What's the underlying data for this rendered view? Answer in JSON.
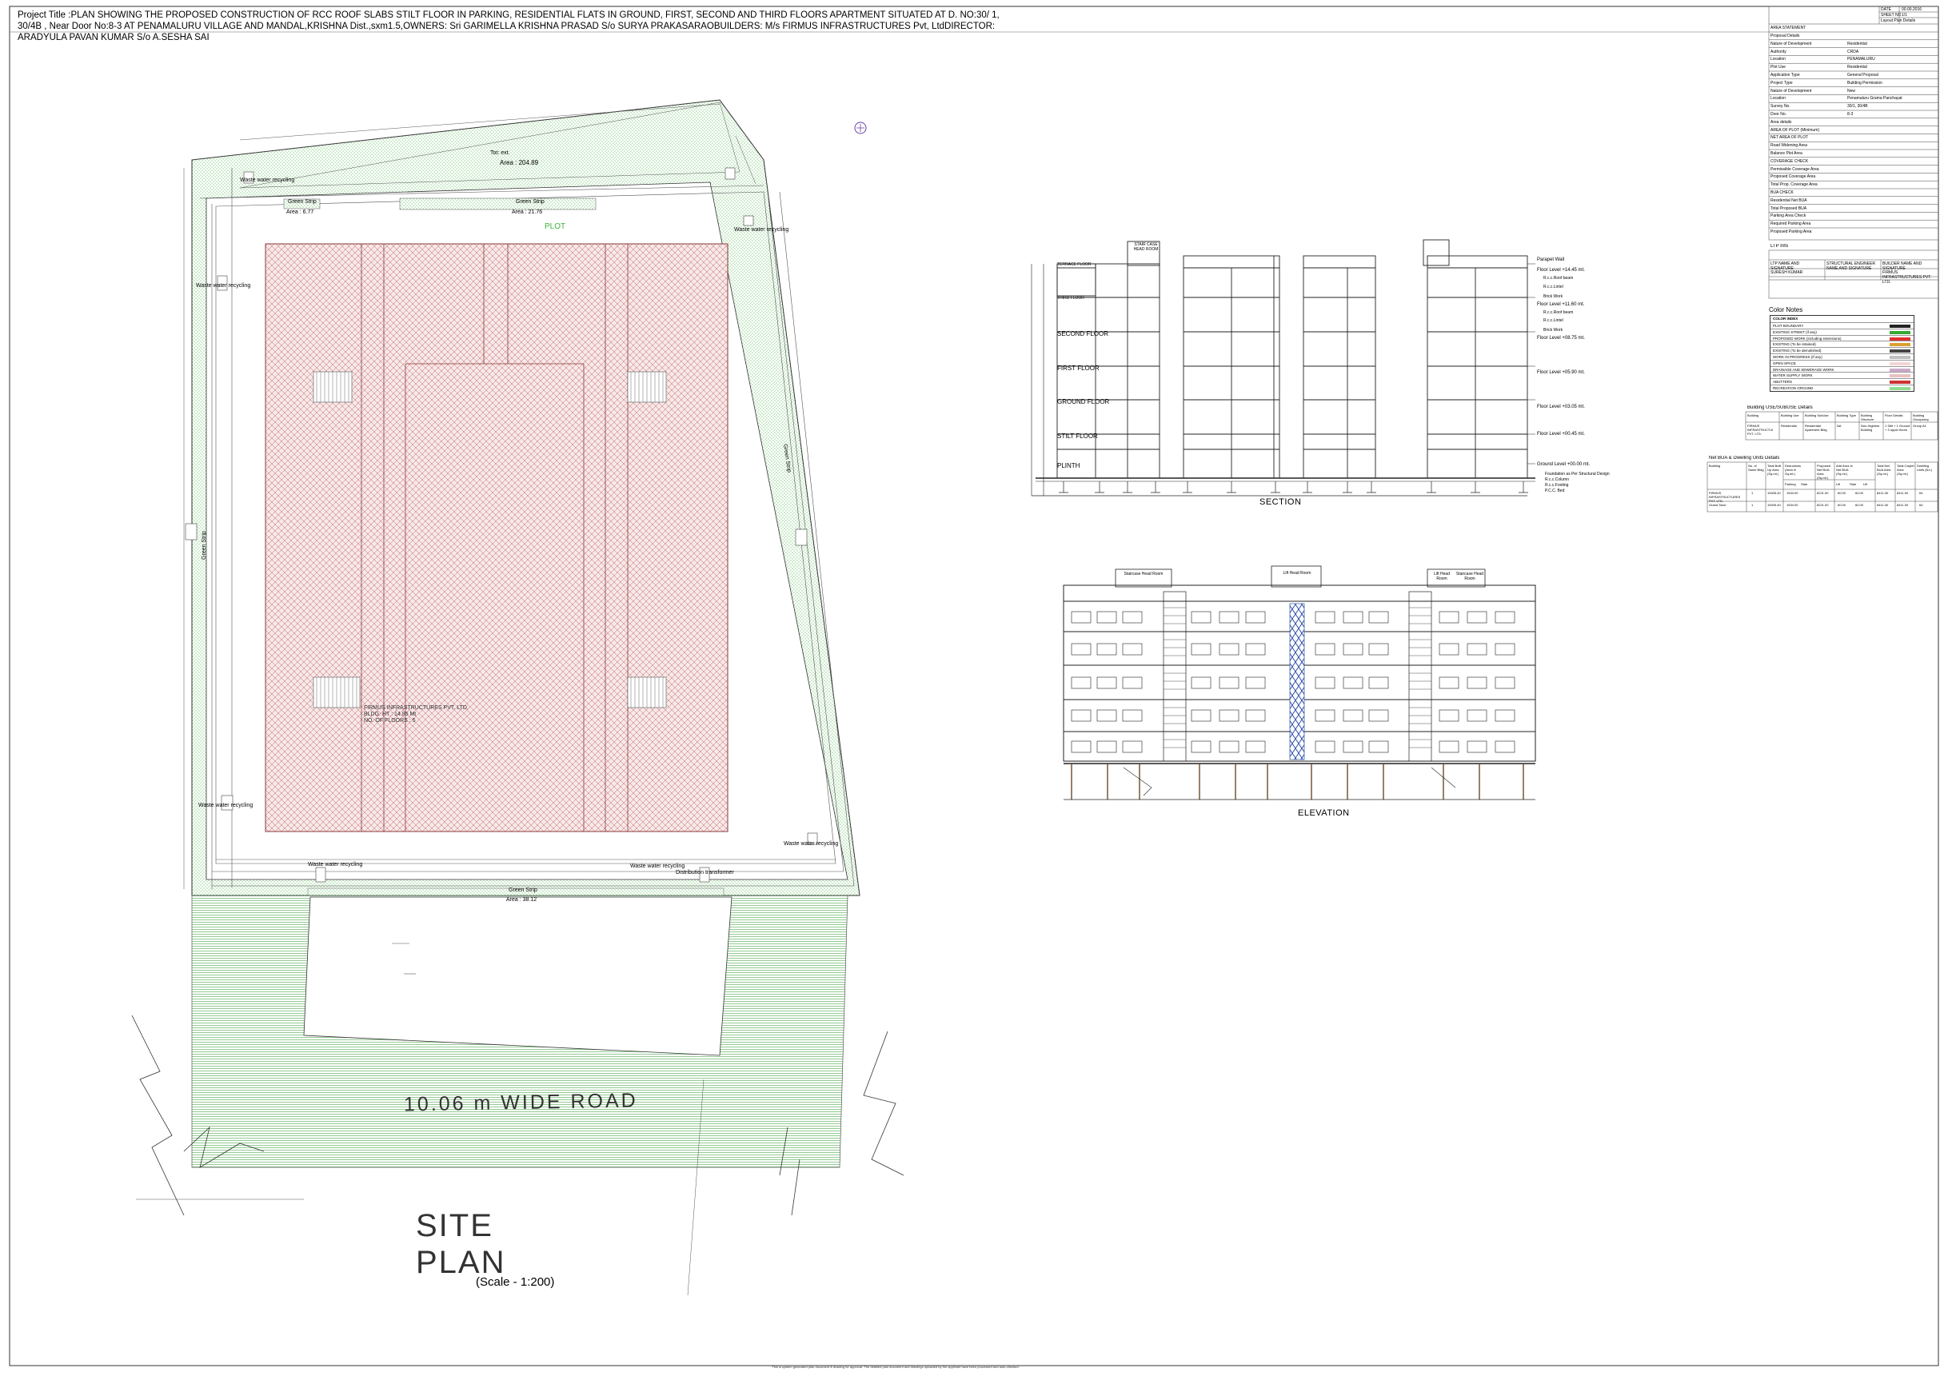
{
  "project_title": "Project Title :PLAN SHOWING THE PROPOSED CONSTRUCTION OF RCC ROOF SLABS STILT FLOOR IN PARKING, RESIDENTIAL FLATS IN GROUND, FIRST, SECOND AND THIRD FLOORS APARTMENT SITUATED AT D. NO:30/ 1, 30/4B , Near Door No:8-3 AT PENAMALURU VILLAGE AND MANDAL,KRISHNA Dist.,sxm1.5,OWNERS: Sri GARIMELLA KRISHNA PRASAD S/o SURYA PRAKASARAOBUILDERS: M/s FIRMUS INFRASTRUCTURES Pvt, LtdDIRECTOR: ARADYULA PAVAN KUMAR S/o A.SESHA SAI",
  "site_plan": {
    "tot_ext_label": "Tot: ext.",
    "tot_ext_area": "Area : 204.89",
    "green_strip_top_left": "Green Strip",
    "green_strip_top_left_area": "Area : 6.77",
    "green_strip_top": "Green Strip",
    "green_strip_top_area": "Area : 21.76",
    "plot_label": "PLOT",
    "green_strip_right": "Green Strip",
    "green_strip_left": "Green Strip",
    "green_strip_bottom": "Green Strip",
    "green_strip_bottom_area": "Area : 38.12",
    "waste_water": "Waste water recycling",
    "distribution_transformer": "Distribution transformer",
    "building_note": "FIRMUS INFRASTRUCTURES PVT. LTD.\nBLDG. HT : 14.85 Mt\nNO. OF FLOORS : 5",
    "road_label": "10.06  m  WIDE  ROAD",
    "site_plan_title_1": "SITE",
    "site_plan_title_2": "PLAN",
    "scale": "(Scale - 1:200)"
  },
  "section": {
    "caption": "SECTION",
    "floors": [
      "TERRACE FLOOR",
      "THIRD FLOOR",
      "SECOND FLOOR",
      "FIRST FLOOR",
      "GROUND FLOOR",
      "STILT FLOOR",
      "PLINTH"
    ],
    "stair_head": "STAIR CASE HEAD ROOM",
    "levels": [
      "Parapet Wall",
      "Floor Level +14.45 mt.",
      "Floor Level +11.60 mt.",
      "Floor Level +08.75 mt.",
      "Floor Level +05.90 mt.",
      "Floor Level +03.05 mt.",
      "Floor Level +00.45 mt.",
      "Ground Level +00.00 mt."
    ],
    "notes": [
      "R.c.c.Roof beam",
      "R.c.c.Lintel",
      "Brick Work",
      "R.c.c.Roof beam",
      "R.c.c.Lintel",
      "Brick Work"
    ],
    "footing_notes": [
      "Foundation as Per Structural Design",
      "R.c.c.Column",
      "R.c.c.Footing",
      "P.C.C. Bed"
    ]
  },
  "elevation": {
    "caption": "ELEVATION",
    "heads": [
      "Staircase Head Room",
      "Lift Head Room",
      "Lift Head Room",
      "Staircase Head Room"
    ]
  },
  "title_block": {
    "date_label": "DATE",
    "date_value": "00.00.2016",
    "sheet_label": "SHEET NO",
    "sheet_value": "1/1",
    "layout_label": "Layout Plan Details",
    "area_statement": "AREA STATEMENT",
    "rows": [
      [
        "Proposal Details",
        ""
      ],
      [
        "Nature of Development",
        "Residential"
      ],
      [
        "Authority",
        "CRDA"
      ],
      [
        "Location",
        "PENAMALURU"
      ],
      [
        "Plot Use",
        "Residential"
      ],
      [
        "Application Type",
        "General Proposal"
      ],
      [
        "Project Type",
        "Building Permission"
      ],
      [
        "Nature of Development",
        "New"
      ],
      [
        "Location",
        "Penamaluru Grama Panchayat"
      ],
      [
        "Survey No.",
        "30/1, 30/4B"
      ],
      [
        "Door No.",
        "8-3"
      ],
      [
        "Area details",
        ""
      ],
      [
        "AREA OF PLOT (Minimum)",
        ""
      ],
      [
        "NET AREA OF PLOT",
        ""
      ],
      [
        "Road Widening Area",
        ""
      ],
      [
        "Balance Plot Area",
        ""
      ],
      [
        "COVERAGE CHECK",
        ""
      ],
      [
        "Permissible Coverage Area",
        ""
      ],
      [
        "Proposed Coverage Area",
        ""
      ],
      [
        "Total Prop. Coverage Area",
        ""
      ],
      [
        "BUA CHECK",
        ""
      ],
      [
        "Residential Net BUA",
        ""
      ],
      [
        "Total Proposed BUA",
        ""
      ],
      [
        "Parking Area Check",
        ""
      ],
      [
        "Required Parking Area",
        ""
      ],
      [
        "Proposed Parking Area",
        ""
      ]
    ],
    "ltp_label": "LTP Info",
    "ltp_headers": [
      "LTP NAME AND SIGNATURE",
      "STRUCTURAL ENGINEER NAME AND SIGNATURE",
      "BUILDER NAME AND SIGNATURE"
    ],
    "ltp_values": [
      "SURESH KUMAR",
      "",
      "FIRMUS INFRASTRUCTURES PVT. LTD."
    ]
  },
  "color_notes": {
    "title": "Color Notes",
    "header": "COLOR INDEX",
    "rows": [
      {
        "label": "PLOT BOUNDARY",
        "color": "#222222"
      },
      {
        "label": "EXISTING STREET (if any)",
        "color": "#33aa33"
      },
      {
        "label": "PROPOSED WORK (including extensions)",
        "color": "#e03030"
      },
      {
        "label": "EXISTING (To be retained)",
        "color": "#d9a030"
      },
      {
        "label": "EXISTING (To be demolished)",
        "color": "#444444"
      },
      {
        "label": "WORK IN PROGRESS (If any)",
        "color": "#c0c0c0"
      },
      {
        "label": "OPEN SPACE",
        "color": "#f3d5d5"
      },
      {
        "label": "DRAINAGE AND SEWERAGE WORK",
        "color": "#caa9c8"
      },
      {
        "label": "WATER SUPPLY WORK",
        "color": "#e9c1c1"
      },
      {
        "label": "ABUTTERS",
        "color": "#cc3333"
      },
      {
        "label": "RECREATION GROUND",
        "color": "#8fdc8f"
      }
    ]
  },
  "building_use": {
    "title": "Building USE/SUBUSE Details",
    "headers": [
      "Building",
      "Building Use",
      "Building SubUse",
      "Building Type",
      "Building Structure",
      "Floor Details",
      "Building Occupancy"
    ],
    "row": [
      "FIRMUS INFRASTRUCTURES PVT. LTD.",
      "Residential",
      "Residential Apartment Bldg",
      "NA",
      "Non-Highrise Building",
      "1 Stilt + 1 Ground + 3 upper floors",
      "Group A1"
    ]
  },
  "net_bua": {
    "title": "Net BUA & Dwelling Units Details",
    "headers": [
      "Building",
      "No. of Same Bldg",
      "Total Built Up Area (Sq.mt.)",
      "Deductions (Area in Sq.mt.)",
      "Proposed Net BUA Area (Sq.mt.)",
      "Add Area In Net BUA (Sq.mt.)",
      "Total Net BUA Area (Sq.mt.)",
      "Total Carpet Area (Sq.mt.)",
      "Dwelling Units (No.)"
    ],
    "sub_headers": [
      "Parking",
      "Stair",
      "Lift",
      "Stair",
      "Lift"
    ],
    "rows": [
      [
        "FIRMUS INFRASTRUCTURES PVT. LTD.",
        "1",
        "10005.40",
        "1534.00",
        "8221.00",
        "60.00",
        "60.00",
        "8411.00",
        "8411.00",
        "64"
      ],
      [
        "Grand Total :",
        "1",
        "10005.40",
        "1534.00",
        "8221.00",
        "60.00",
        "60.00",
        "8411.00",
        "8411.00",
        "64"
      ]
    ]
  },
  "footer": "This is system generated plan document & drawing for approval. The detailed plan document and drawings uploaded by the applicant have been processed and auto-checked."
}
